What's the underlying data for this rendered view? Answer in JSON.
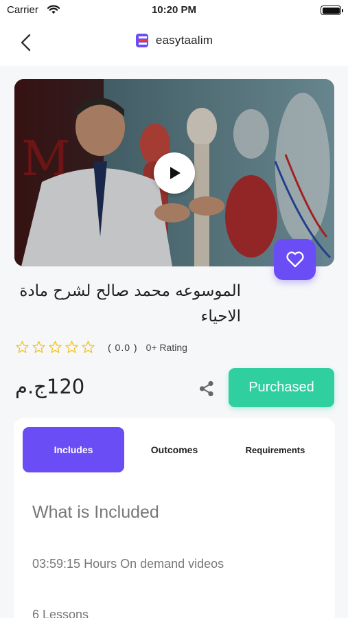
{
  "status_bar": {
    "carrier": "Carrier",
    "time": "10:20 PM"
  },
  "nav": {
    "brand_name": "easytaalim"
  },
  "course": {
    "title": "الموسوعه محمد صالح لشرح مادة الاحياء",
    "rating_score": "( 0.0 )",
    "rating_label": "0+ Rating",
    "price": "120ج.م",
    "purchased_label": "Purchased"
  },
  "tabs": [
    {
      "label": "Includes",
      "active": true
    },
    {
      "label": "Outcomes",
      "active": false
    },
    {
      "label": "Requirements",
      "active": false
    }
  ],
  "includes": {
    "title": "What is Included",
    "items": [
      "03:59:15 Hours On demand videos",
      "6 Lessons"
    ]
  },
  "colors": {
    "accent": "#6a4df4",
    "success": "#2fcf9f",
    "star": "#f2c21b"
  },
  "icons": [
    "back-icon",
    "brand-logo-icon",
    "play-icon",
    "heart-icon",
    "star-icon",
    "share-icon"
  ]
}
